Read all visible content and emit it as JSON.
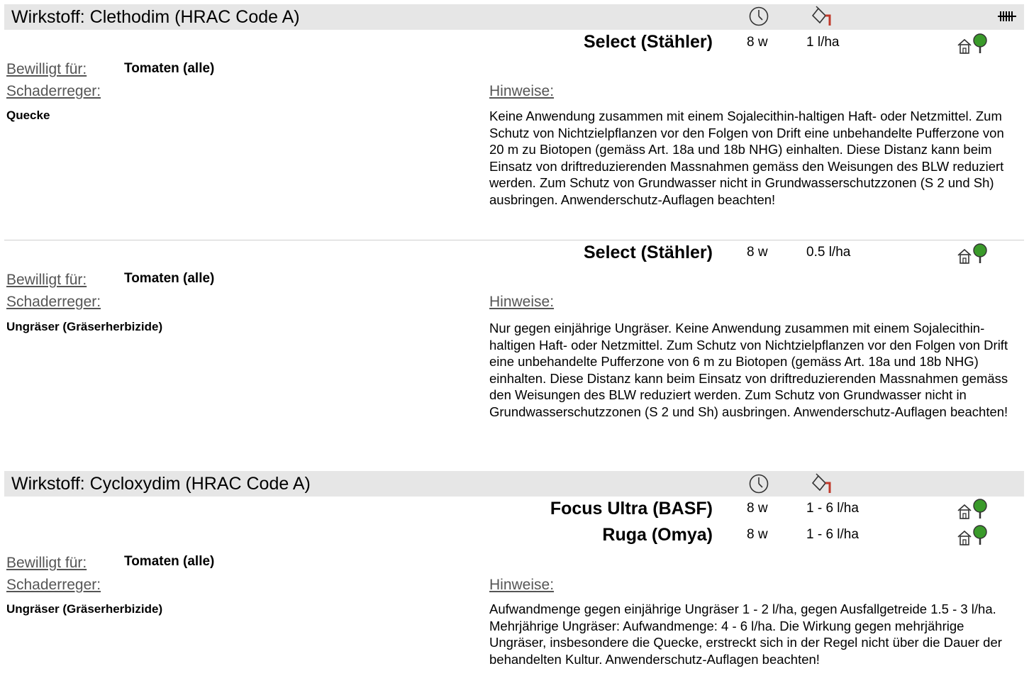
{
  "labels": {
    "approved_for": "Bewilligt für:",
    "pest": "Schaderreger:",
    "notes": "Hinweise:"
  },
  "icons": {
    "column_waiting": "clock-icon",
    "column_dose": "watering-can-icon",
    "header_extra": "bar-mark-icon",
    "product_usage": "house-and-tree-icon"
  },
  "colors": {
    "header_bg": "#e6e6e6",
    "icon_red": "#c0392b",
    "tree_green": "#3a9a2a"
  },
  "sections": [
    {
      "title": "Wirkstoff: Clethodim (HRAC Code A)",
      "blocks": [
        {
          "products": [
            {
              "name": "Select (Stähler)",
              "wait": "8 w",
              "dose": "1 l/ha"
            }
          ],
          "approved_for": "Tomaten (alle)",
          "pest": "Quecke",
          "notes": "Keine Anwendung zusammen mit einem Sojalecithin-haltigen Haft- oder Netzmittel. Zum Schutz von Nichtzielpflanzen vor den Folgen von Drift eine unbehandelte Pufferzone von 20 m zu Biotopen (gemäss Art. 18a und 18b NHG) einhalten. Diese Distanz kann beim Einsatz von driftreduzierenden Massnahmen gemäss den Weisungen des BLW reduziert werden. Zum Schutz von Grundwasser nicht in Grundwasserschutzzonen (S 2 und Sh) ausbringen. Anwenderschutz-Auflagen beachten!"
        },
        {
          "products": [
            {
              "name": "Select (Stähler)",
              "wait": "8 w",
              "dose": "0.5  l/ha"
            }
          ],
          "approved_for": "Tomaten (alle)",
          "pest": "Ungräser (Gräserherbizide)",
          "notes": "Nur gegen einjährige Ungräser. Keine Anwendung zusammen mit einem Sojalecithin-haltigen Haft- oder Netzmittel. Zum Schutz von Nichtzielpflanzen vor den Folgen von Drift eine unbehandelte Pufferzone von 6 m zu Biotopen (gemäss Art. 18a und 18b NHG) einhalten. Diese Distanz kann beim Einsatz von driftreduzierenden Massnahmen gemäss den Weisungen des BLW reduziert werden. Zum Schutz von Grundwasser nicht in Grundwasserschutzzonen (S 2 und Sh) ausbringen. Anwenderschutz-Auflagen beachten!"
        }
      ]
    },
    {
      "title": "Wirkstoff: Cycloxydim (HRAC Code A)",
      "blocks": [
        {
          "products": [
            {
              "name": "Focus Ultra (BASF)",
              "wait": "8 w",
              "dose": "1 - 6 l/ha"
            },
            {
              "name": "Ruga (Omya)",
              "wait": "8 w",
              "dose": "1 - 6 l/ha"
            }
          ],
          "approved_for": "Tomaten (alle)",
          "pest": "Ungräser (Gräserherbizide)",
          "notes": "Aufwandmenge gegen einjährige Ungräser 1 - 2 l/ha, gegen Ausfallgetreide 1.5 - 3 l/ha. Mehrjährige Ungräser: Aufwandmenge: 4 - 6 l/ha. Die Wirkung gegen mehrjährige Ungräser, insbesondere die Quecke, erstreckt sich in der Regel nicht über die Dauer der behandelten Kultur. Anwenderschutz-Auflagen beachten!"
        }
      ]
    }
  ]
}
